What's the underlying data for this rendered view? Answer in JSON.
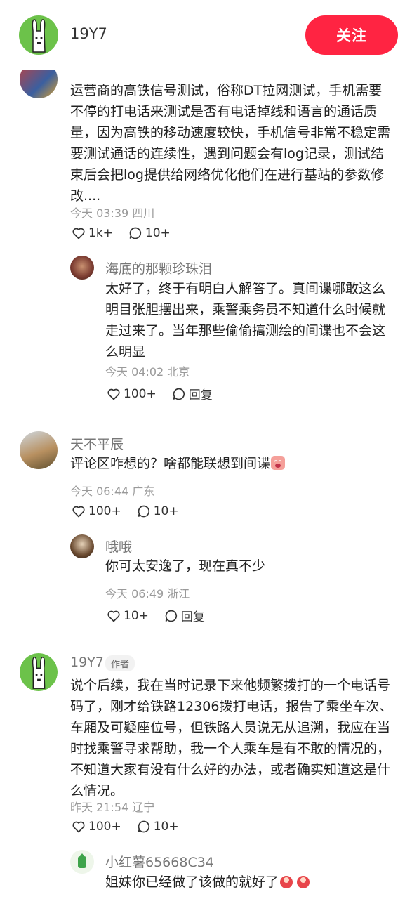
{
  "header": {
    "username": "19Y7",
    "follow_label": "关注"
  },
  "comments": [
    {
      "lines": [
        "运营商的高铁信号测试，俗称DT拉网测试，手机需要",
        "不停的打电话来测试是否有电话掉线和语言的通话质",
        "量，因为高铁的移动速度较快，手机信号非常不稳定需",
        "要测试通话的连续性，遇到问题会有log记录，测试结",
        "束后会把log提供给网络优化他们在进行基站的参数修",
        "改...."
      ],
      "meta": "今天 03:39 四川",
      "likes": "1k+",
      "replies": "10+",
      "icons": [
        "heart-icon",
        "comment-bubble-icon"
      ],
      "reply": {
        "name": "海底的那颗珍珠泪",
        "lines": [
          "太好了，终于有明白人解答了。真间谍哪敢这么",
          "明目张胆摆出来，乘警乘务员不知道什么时候就",
          "走过来了。当年那些偷偷搞测绘的间谍也不会这",
          "么明显"
        ],
        "meta": "今天 04:02 北京",
        "likes": "100+",
        "reply_label": "回复"
      }
    },
    {
      "name": "天不平辰",
      "lines": [
        "评论区咋想的？啥都能联想到间谍"
      ],
      "meta": "今天 06:44 广东",
      "likes": "100+",
      "replies": "10+",
      "reply": {
        "name": "哦哦",
        "lines": [
          "你可太安逸了，现在真不少"
        ],
        "meta": "今天 06:49 浙江",
        "likes": "10+",
        "reply_label": "回复"
      }
    },
    {
      "name": "19Y7",
      "author_tag": "作者",
      "lines": [
        "说个后续，我在当时记录下来他频繁拨打的一个电话号",
        "码了，刚才给铁路12306拨打电话，报告了乘坐车次、",
        "车厢及可疑座位号，但铁路人员说无从追溯，我应在当",
        "时找乘警寻求帮助，我一个人乘车是有不敢的情况的，",
        "不知道大家有没有什么好的办法，或者确实知道这是什",
        "么情况。"
      ],
      "meta": "昨天 21:54 辽宁",
      "likes": "100+",
      "replies": "10+",
      "reply": {
        "name": "小红薯65668C34",
        "lines": [
          "姐妹你已经做了该做的就好了"
        ]
      }
    }
  ]
}
